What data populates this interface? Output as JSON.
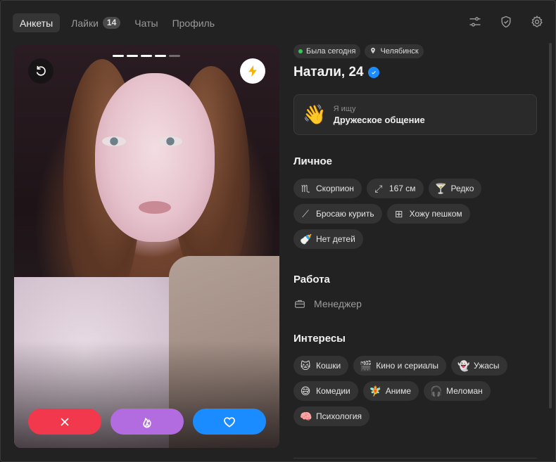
{
  "nav": {
    "items": [
      {
        "label": "Анкеты",
        "active": true
      },
      {
        "label": "Лайки",
        "badge": "14"
      },
      {
        "label": "Чаты"
      },
      {
        "label": "Профиль"
      }
    ]
  },
  "top_icons": [
    "sliders-icon",
    "shield-check-icon",
    "gear-icon"
  ],
  "photo": {
    "total_photos": 5,
    "current_photo": 4
  },
  "profile": {
    "status": "Была сегодня",
    "city": "Челябинск",
    "name_age": "Натали, 24",
    "verified": true,
    "seeking": {
      "label": "Я ищу",
      "value": "Дружеское общение"
    },
    "personal_title": "Личное",
    "personal": [
      {
        "icon": "♏",
        "label": "Скорпион"
      },
      {
        "icon": "⤢",
        "label": "167 см"
      },
      {
        "icon": "🍸",
        "label": "Редко"
      },
      {
        "icon": "⟋",
        "label": "Бросаю курить"
      },
      {
        "icon": "⊞",
        "label": "Хожу пешком"
      },
      {
        "icon": "🍼",
        "label": "Нет детей"
      }
    ],
    "work_title": "Работа",
    "work": "Менеджер",
    "interests_title": "Интересы",
    "interests": [
      {
        "icon": "🐱",
        "label": "Кошки"
      },
      {
        "icon": "🎬",
        "label": "Кино и сериалы"
      },
      {
        "icon": "👻",
        "label": "Ужасы"
      },
      {
        "icon": "😅",
        "label": "Комедии"
      },
      {
        "icon": "🧚",
        "label": "Аниме"
      },
      {
        "icon": "🎧",
        "label": "Меломан"
      },
      {
        "icon": "🧠",
        "label": "Психология"
      }
    ]
  },
  "colors": {
    "dislike": "#f2384d",
    "superlike": "#b36ce0",
    "like": "#1a8cff",
    "online": "#35c759",
    "boost": "#f5b400"
  }
}
